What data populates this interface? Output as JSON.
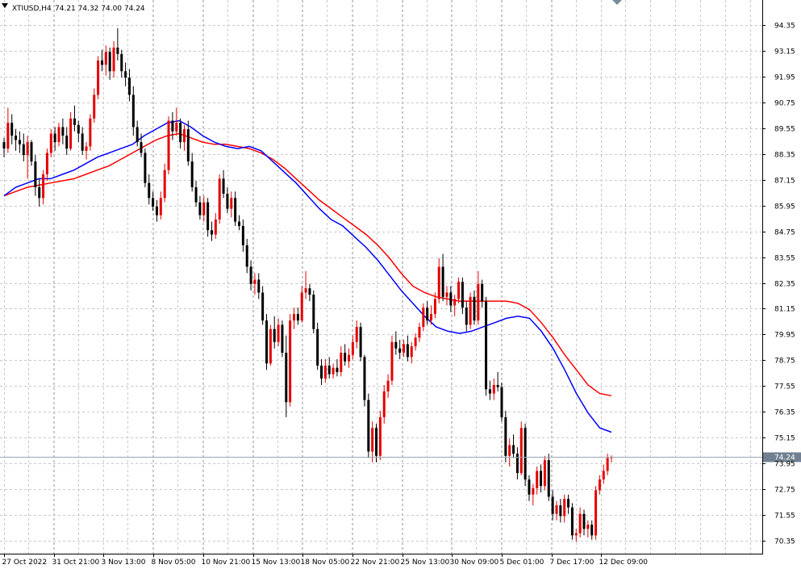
{
  "header": {
    "symbol": "XTIUSD,H4",
    "ohlc": "74.21 74.32 74.00 74.24"
  },
  "colors": {
    "background": "#ffffff",
    "grid": "#c8c8c8",
    "bull": "#e50000",
    "bear": "#000000",
    "ma_fast": "#0000ff",
    "ma_slow": "#ff0000",
    "current_price_line": "#9aa6b4",
    "current_price_box": "#708090"
  },
  "chart_data": {
    "type": "candlestick",
    "symbol": "XTIUSD",
    "timeframe": "H4",
    "y_ticks": [
      "94.35",
      "93.15",
      "91.95",
      "90.75",
      "89.55",
      "88.35",
      "87.15",
      "85.95",
      "84.75",
      "83.55",
      "82.35",
      "81.15",
      "79.95",
      "78.75",
      "77.55",
      "76.35",
      "75.15",
      "73.95",
      "72.75",
      "71.55",
      "70.35"
    ],
    "ylim": [
      69.75,
      94.95
    ],
    "x_ticks": [
      "27 Oct 2022",
      "31 Oct 21:00",
      "3 Nov 13:00",
      "8 Nov 05:00",
      "10 Nov 21:00",
      "15 Nov 13:00",
      "18 Nov 05:00",
      "22 Nov 21:00",
      "25 Nov 13:00",
      "30 Nov 09:00",
      "5 Dec 01:00",
      "7 Dec 17:00",
      "12 Dec 09:00"
    ],
    "current_price": "74.24",
    "grid": true,
    "candles": [
      [
        88.9,
        89.1,
        88.2,
        88.6
      ],
      [
        88.6,
        90.5,
        88.4,
        89.8
      ],
      [
        89.8,
        90.2,
        88.8,
        89.2
      ],
      [
        89.2,
        89.5,
        88.5,
        89.0
      ],
      [
        89.0,
        89.4,
        88.4,
        88.8
      ],
      [
        88.8,
        89.3,
        88.0,
        88.3
      ],
      [
        88.3,
        89.2,
        87.2,
        88.9
      ],
      [
        88.9,
        89.0,
        87.8,
        88.0
      ],
      [
        88.0,
        88.3,
        86.4,
        86.8
      ],
      [
        86.8,
        87.2,
        85.9,
        86.3
      ],
      [
        86.3,
        87.6,
        86.0,
        87.4
      ],
      [
        87.4,
        88.6,
        87.1,
        88.4
      ],
      [
        88.4,
        89.5,
        88.2,
        89.3
      ],
      [
        89.3,
        89.6,
        88.5,
        88.9
      ],
      [
        88.9,
        89.8,
        88.7,
        89.6
      ],
      [
        89.6,
        90.0,
        88.8,
        89.2
      ],
      [
        89.2,
        89.6,
        88.3,
        88.6
      ],
      [
        88.6,
        90.3,
        88.5,
        90.0
      ],
      [
        90.0,
        90.6,
        89.4,
        89.7
      ],
      [
        89.7,
        89.9,
        88.9,
        89.3
      ],
      [
        89.3,
        89.6,
        88.3,
        88.5
      ],
      [
        88.5,
        88.9,
        88.1,
        88.7
      ],
      [
        88.7,
        90.2,
        88.5,
        90.0
      ],
      [
        90.0,
        91.4,
        89.8,
        91.1
      ],
      [
        91.1,
        92.9,
        90.9,
        92.7
      ],
      [
        92.7,
        93.2,
        92.2,
        92.5
      ],
      [
        92.5,
        93.4,
        92.0,
        93.1
      ],
      [
        93.1,
        93.3,
        91.8,
        92.2
      ],
      [
        92.2,
        93.6,
        91.9,
        93.3
      ],
      [
        93.3,
        94.2,
        92.7,
        93.0
      ],
      [
        93.0,
        93.2,
        91.9,
        92.2
      ],
      [
        92.2,
        92.6,
        91.5,
        91.9
      ],
      [
        91.9,
        92.3,
        90.8,
        91.1
      ],
      [
        91.1,
        91.5,
        89.2,
        89.6
      ],
      [
        89.6,
        89.9,
        88.7,
        88.9
      ],
      [
        88.9,
        89.3,
        88.2,
        88.4
      ],
      [
        88.4,
        88.6,
        86.8,
        87.0
      ],
      [
        87.0,
        87.4,
        86.0,
        86.3
      ],
      [
        86.3,
        86.6,
        85.7,
        85.9
      ],
      [
        85.9,
        86.2,
        85.2,
        85.5
      ],
      [
        85.5,
        86.6,
        85.3,
        86.3
      ],
      [
        86.3,
        87.9,
        86.1,
        87.6
      ],
      [
        87.6,
        90.1,
        87.4,
        89.9
      ],
      [
        89.9,
        90.3,
        89.0,
        89.4
      ],
      [
        89.4,
        90.5,
        89.2,
        89.8
      ],
      [
        89.8,
        90.0,
        88.6,
        88.9
      ],
      [
        88.9,
        89.7,
        88.5,
        89.5
      ],
      [
        89.5,
        89.9,
        87.8,
        88.0
      ],
      [
        88.0,
        88.4,
        86.6,
        86.8
      ],
      [
        86.8,
        87.1,
        85.9,
        86.1
      ],
      [
        86.1,
        86.4,
        85.3,
        85.5
      ],
      [
        85.5,
        86.4,
        85.2,
        86.1
      ],
      [
        86.1,
        86.3,
        84.5,
        84.8
      ],
      [
        84.8,
        85.2,
        84.3,
        84.6
      ],
      [
        84.6,
        85.6,
        84.4,
        85.3
      ],
      [
        85.3,
        87.4,
        85.1,
        87.2
      ],
      [
        87.2,
        87.6,
        86.3,
        86.5
      ],
      [
        86.5,
        86.8,
        85.6,
        85.8
      ],
      [
        85.8,
        86.6,
        85.4,
        86.3
      ],
      [
        86.3,
        86.6,
        85.0,
        85.2
      ],
      [
        85.2,
        85.5,
        84.8,
        85.0
      ],
      [
        85.0,
        85.3,
        83.8,
        84.1
      ],
      [
        84.1,
        84.4,
        82.8,
        83.1
      ],
      [
        83.1,
        83.4,
        82.0,
        82.3
      ],
      [
        82.3,
        82.8,
        81.8,
        82.5
      ],
      [
        82.5,
        82.8,
        81.6,
        81.9
      ],
      [
        81.9,
        82.2,
        80.4,
        80.6
      ],
      [
        80.6,
        80.9,
        78.3,
        78.6
      ],
      [
        78.6,
        80.4,
        78.5,
        80.2
      ],
      [
        80.2,
        80.8,
        79.3,
        79.6
      ],
      [
        79.6,
        80.7,
        79.4,
        80.4
      ],
      [
        80.4,
        80.6,
        78.9,
        79.1
      ],
      [
        79.1,
        79.9,
        76.1,
        76.8
      ],
      [
        76.8,
        80.9,
        76.6,
        80.6
      ],
      [
        80.6,
        81.2,
        80.2,
        80.9
      ],
      [
        80.9,
        81.2,
        80.4,
        80.6
      ],
      [
        80.6,
        82.2,
        80.5,
        81.9
      ],
      [
        81.9,
        82.9,
        81.6,
        82.1
      ],
      [
        82.1,
        82.3,
        81.5,
        81.8
      ],
      [
        81.8,
        82.0,
        80.0,
        80.2
      ],
      [
        80.2,
        80.5,
        78.3,
        78.5
      ],
      [
        78.5,
        78.8,
        77.6,
        77.9
      ],
      [
        77.9,
        78.8,
        77.7,
        78.5
      ],
      [
        78.5,
        78.9,
        77.9,
        78.1
      ],
      [
        78.1,
        78.6,
        77.9,
        78.4
      ],
      [
        78.4,
        78.8,
        78.0,
        78.2
      ],
      [
        78.2,
        79.4,
        78.0,
        79.1
      ],
      [
        79.1,
        79.5,
        78.5,
        78.7
      ],
      [
        78.7,
        79.3,
        78.4,
        79.0
      ],
      [
        79.0,
        79.9,
        78.8,
        79.6
      ],
      [
        79.6,
        80.6,
        79.3,
        80.3
      ],
      [
        80.3,
        80.5,
        78.7,
        78.9
      ],
      [
        78.9,
        79.0,
        76.6,
        76.9
      ],
      [
        76.9,
        77.2,
        74.2,
        74.5
      ],
      [
        74.5,
        75.9,
        74.0,
        75.6
      ],
      [
        75.6,
        75.8,
        74.0,
        74.3
      ],
      [
        74.3,
        76.4,
        74.1,
        76.1
      ],
      [
        76.1,
        77.6,
        75.8,
        77.3
      ],
      [
        77.3,
        78.1,
        77.0,
        77.8
      ],
      [
        77.8,
        79.9,
        77.6,
        79.6
      ],
      [
        79.6,
        80.1,
        79.0,
        79.3
      ],
      [
        79.3,
        79.7,
        78.8,
        79.1
      ],
      [
        79.1,
        79.7,
        78.9,
        79.5
      ],
      [
        79.5,
        79.9,
        78.7,
        78.9
      ],
      [
        78.9,
        79.6,
        78.6,
        79.4
      ],
      [
        79.4,
        80.0,
        79.2,
        79.8
      ],
      [
        79.8,
        80.5,
        79.6,
        80.3
      ],
      [
        80.3,
        81.4,
        80.1,
        81.2
      ],
      [
        81.2,
        81.5,
        80.4,
        80.6
      ],
      [
        80.6,
        81.3,
        80.4,
        80.9
      ],
      [
        80.9,
        81.9,
        80.7,
        81.6
      ],
      [
        81.6,
        83.5,
        81.4,
        83.1
      ],
      [
        83.1,
        83.7,
        81.5,
        81.7
      ],
      [
        81.7,
        82.2,
        81.3,
        81.9
      ],
      [
        81.9,
        82.2,
        81.0,
        81.3
      ],
      [
        81.3,
        81.8,
        80.8,
        81.6
      ],
      [
        81.6,
        82.6,
        81.4,
        82.4
      ],
      [
        82.4,
        82.6,
        80.9,
        81.2
      ],
      [
        81.2,
        81.5,
        80.1,
        80.4
      ],
      [
        80.4,
        81.9,
        80.2,
        81.7
      ],
      [
        81.7,
        82.0,
        80.4,
        80.6
      ],
      [
        80.6,
        82.9,
        80.4,
        82.3
      ],
      [
        82.3,
        82.5,
        81.2,
        81.5
      ],
      [
        81.5,
        81.7,
        77.1,
        77.4
      ],
      [
        77.4,
        77.8,
        76.9,
        77.2
      ],
      [
        77.2,
        77.9,
        76.9,
        77.6
      ],
      [
        77.6,
        78.2,
        77.3,
        77.5
      ],
      [
        77.5,
        77.7,
        75.9,
        76.1
      ],
      [
        76.1,
        76.4,
        74.0,
        74.3
      ],
      [
        74.3,
        75.1,
        73.8,
        74.8
      ],
      [
        74.8,
        75.3,
        74.2,
        74.4
      ],
      [
        74.4,
        74.7,
        73.2,
        73.5
      ],
      [
        73.5,
        75.9,
        73.4,
        75.6
      ],
      [
        75.6,
        75.8,
        72.9,
        73.2
      ],
      [
        73.2,
        73.4,
        72.2,
        72.5
      ],
      [
        72.5,
        73.0,
        72.0,
        72.8
      ],
      [
        72.8,
        73.8,
        72.5,
        73.6
      ],
      [
        73.6,
        73.9,
        72.6,
        72.9
      ],
      [
        72.9,
        74.3,
        72.7,
        74.1
      ],
      [
        74.1,
        74.4,
        72.2,
        72.4
      ],
      [
        72.4,
        72.7,
        71.3,
        71.6
      ],
      [
        71.6,
        72.2,
        71.3,
        72.0
      ],
      [
        72.0,
        72.3,
        71.2,
        71.5
      ],
      [
        71.5,
        72.5,
        71.2,
        72.3
      ],
      [
        72.3,
        72.5,
        71.6,
        71.9
      ],
      [
        71.9,
        72.1,
        70.4,
        70.6
      ],
      [
        70.6,
        70.9,
        70.3,
        70.7
      ],
      [
        70.7,
        71.9,
        70.5,
        71.6
      ],
      [
        71.6,
        71.8,
        70.6,
        70.9
      ],
      [
        70.9,
        71.3,
        70.5,
        71.1
      ],
      [
        71.1,
        71.3,
        70.4,
        70.6
      ],
      [
        70.6,
        72.9,
        70.4,
        72.7
      ],
      [
        72.7,
        73.4,
        72.5,
        73.2
      ],
      [
        73.2,
        73.9,
        73.0,
        73.6
      ],
      [
        73.6,
        74.4,
        73.4,
        74.2
      ],
      [
        74.21,
        74.32,
        74.0,
        74.24
      ]
    ],
    "ma_fast": [
      86.4,
      86.8,
      87.0,
      87.2,
      87.2,
      87.4,
      87.6,
      87.9,
      88.2,
      88.4,
      88.6,
      88.8,
      89.2,
      89.5,
      89.8,
      89.9,
      89.6,
      89.2,
      88.9,
      88.7,
      88.6,
      88.7,
      88.5,
      88.0,
      87.5,
      87.0,
      86.4,
      85.8,
      85.3,
      85.0,
      84.5,
      84.0,
      83.4,
      82.7,
      82.0,
      81.4,
      80.8,
      80.3,
      80.1,
      80.0,
      80.1,
      80.3,
      80.5,
      80.7,
      80.8,
      80.7,
      80.1,
      79.3,
      78.3,
      77.2,
      76.3,
      75.6,
      75.4
    ],
    "ma_slow": [
      86.4,
      86.6,
      86.8,
      86.9,
      87.0,
      87.1,
      87.2,
      87.4,
      87.6,
      87.8,
      88.1,
      88.4,
      88.7,
      89.0,
      89.2,
      89.3,
      89.1,
      88.9,
      88.8,
      88.8,
      88.7,
      88.6,
      88.4,
      88.1,
      87.7,
      87.2,
      86.7,
      86.2,
      85.8,
      85.4,
      85.0,
      84.6,
      84.1,
      83.5,
      82.8,
      82.2,
      81.9,
      81.7,
      81.6,
      81.5,
      81.5,
      81.5,
      81.5,
      81.5,
      81.4,
      81.1,
      80.5,
      79.8,
      79.0,
      78.3,
      77.6,
      77.2,
      77.1
    ]
  }
}
